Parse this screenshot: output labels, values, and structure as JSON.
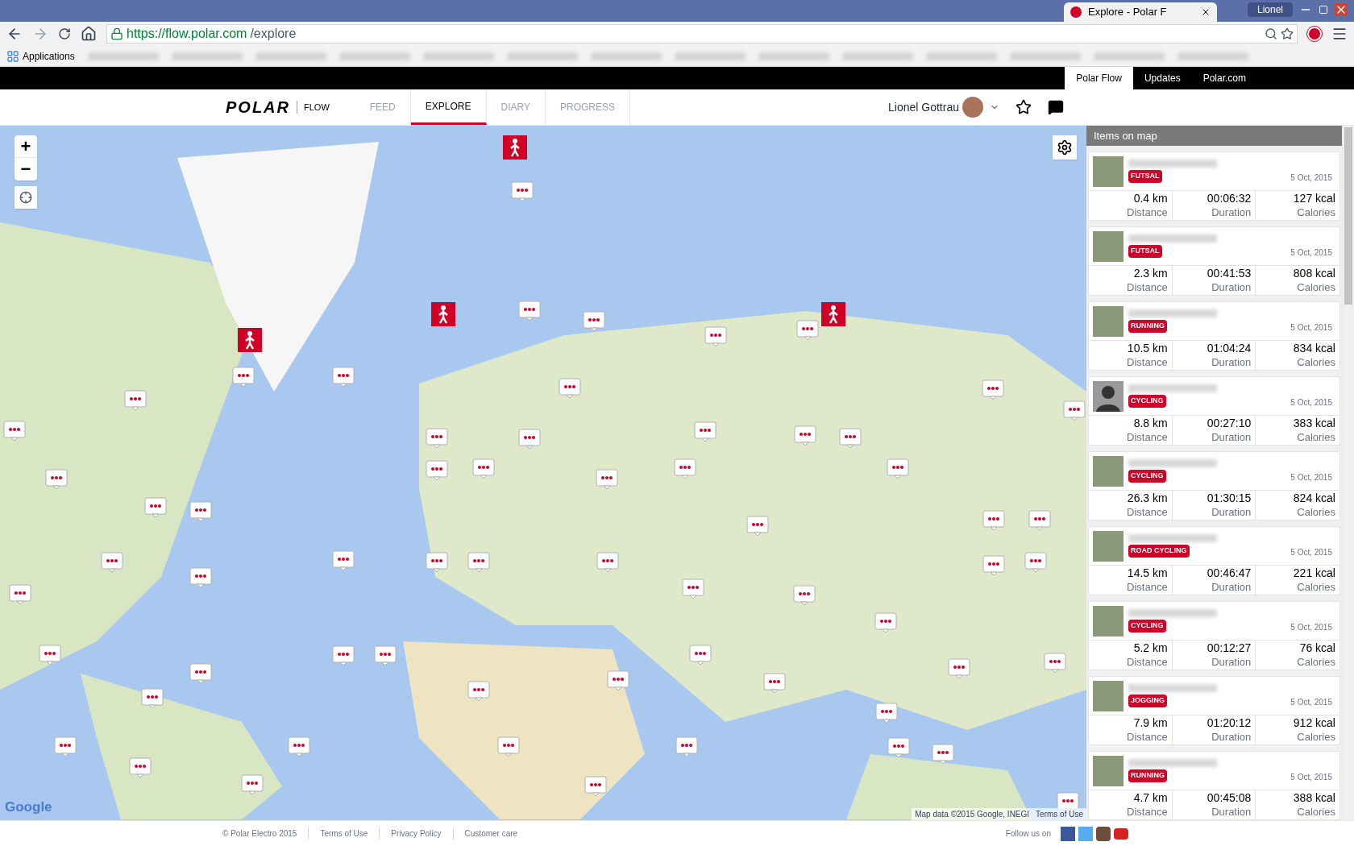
{
  "browser": {
    "tabs": [
      {
        "title": "Explore - Polar F",
        "selected": true
      }
    ],
    "user": "Lionel",
    "url_host": "https://flow.polar.com",
    "url_path": "/explore",
    "bookmarks": [
      "Applications"
    ]
  },
  "top_bar": {
    "links": [
      {
        "label": "Polar Flow",
        "selected": true
      },
      {
        "label": "Updates",
        "selected": false
      },
      {
        "label": "Polar.com",
        "selected": false
      }
    ]
  },
  "header": {
    "logo": "POLAR",
    "product": "FLOW",
    "nav": [
      {
        "label": "FEED",
        "selected": false
      },
      {
        "label": "EXPLORE",
        "selected": true
      },
      {
        "label": "DIARY",
        "selected": false
      },
      {
        "label": "PROGRESS",
        "selected": false
      }
    ],
    "user": "Lionel Gottrau"
  },
  "map": {
    "zoom_in": "+",
    "zoom_out": "−",
    "logo": "Google",
    "attribution": "Map data ©2015 Google, INEGI",
    "terms": "Terms of Use"
  },
  "sidebar": {
    "title": "Items on map",
    "items": [
      {
        "default_avatar": false,
        "sport": "FUTSAL",
        "date": "5 Oct, 2015",
        "stats": [
          {
            "value": "0.4 km",
            "label": "Distance"
          },
          {
            "value": "00:06:32",
            "label": "Duration"
          },
          {
            "value": "127 kcal",
            "label": "Calories"
          }
        ]
      },
      {
        "default_avatar": false,
        "sport": "FUTSAL",
        "date": "5 Oct, 2015",
        "stats": [
          {
            "value": "2.3 km",
            "label": "Distance"
          },
          {
            "value": "00:41:53",
            "label": "Duration"
          },
          {
            "value": "808 kcal",
            "label": "Calories"
          }
        ]
      },
      {
        "default_avatar": false,
        "sport": "RUNNING",
        "date": "5 Oct, 2015",
        "stats": [
          {
            "value": "10.5 km",
            "label": "Distance"
          },
          {
            "value": "01:04:24",
            "label": "Duration"
          },
          {
            "value": "834 kcal",
            "label": "Calories"
          }
        ]
      },
      {
        "default_avatar": true,
        "sport": "CYCLING",
        "date": "5 Oct, 2015",
        "stats": [
          {
            "value": "8.8 km",
            "label": "Distance"
          },
          {
            "value": "00:27:10",
            "label": "Duration"
          },
          {
            "value": "383 kcal",
            "label": "Calories"
          }
        ]
      },
      {
        "default_avatar": false,
        "sport": "CYCLING",
        "date": "5 Oct, 2015",
        "stats": [
          {
            "value": "26.3 km",
            "label": "Distance"
          },
          {
            "value": "01:30:15",
            "label": "Duration"
          },
          {
            "value": "824 kcal",
            "label": "Calories"
          }
        ]
      },
      {
        "default_avatar": false,
        "sport": "ROAD CYCLING",
        "date": "5 Oct, 2015",
        "stats": [
          {
            "value": "14.5 km",
            "label": "Distance"
          },
          {
            "value": "00:46:47",
            "label": "Duration"
          },
          {
            "value": "221 kcal",
            "label": "Calories"
          }
        ]
      },
      {
        "default_avatar": false,
        "sport": "CYCLING",
        "date": "5 Oct, 2015",
        "stats": [
          {
            "value": "5.2 km",
            "label": "Distance"
          },
          {
            "value": "00:12:27",
            "label": "Duration"
          },
          {
            "value": "76 kcal",
            "label": "Calories"
          }
        ]
      },
      {
        "default_avatar": false,
        "sport": "JOGGING",
        "date": "5 Oct, 2015",
        "stats": [
          {
            "value": "7.9 km",
            "label": "Distance"
          },
          {
            "value": "01:20:12",
            "label": "Duration"
          },
          {
            "value": "912 kcal",
            "label": "Calories"
          }
        ]
      },
      {
        "default_avatar": false,
        "sport": "RUNNING",
        "date": "5 Oct, 2015",
        "stats": [
          {
            "value": "4.7 km",
            "label": "Distance"
          },
          {
            "value": "00:45:08",
            "label": "Duration"
          },
          {
            "value": "388 kcal",
            "label": "Calories"
          }
        ]
      }
    ]
  },
  "footer": {
    "copyright": "© Polar Electro 2015",
    "links": [
      "Terms of Use",
      "Privacy Policy",
      "Customer care"
    ],
    "follow": "Follow us on"
  }
}
